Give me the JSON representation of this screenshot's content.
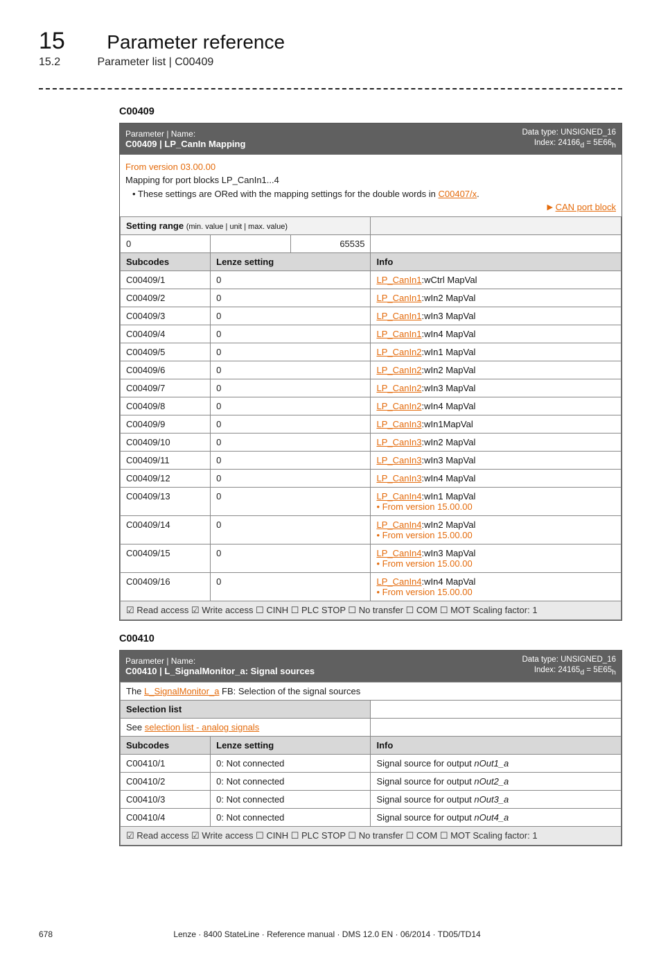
{
  "header": {
    "chapter_number": "15",
    "chapter_title": "Parameter reference",
    "section_number": "15.2",
    "section_title": "Parameter list | C00409"
  },
  "anchor_409": "C00409",
  "table409": {
    "head_small": "Parameter | Name:",
    "head_name": "C00409 | LP_CanIn Mapping",
    "dtype": "Data type: UNSIGNED_16",
    "idx_prefix": "Index: 24166",
    "idx_d": "d",
    "idx_mid": " = 5E66",
    "idx_h": "h",
    "desc_version": "From version 03.00.00",
    "desc_mapping": "Mapping for port blocks LP_CanIn1...4",
    "desc_bullet_pre": "• These settings are ORed with the mapping settings for the double words in ",
    "desc_bullet_link": "C00407/x",
    "desc_bullet_post": ".",
    "right_link": "CAN port block",
    "setting_range_label": "Setting range ",
    "setting_range_small": "(min. value | unit | max. value)",
    "range_min": "0",
    "range_max": "65535",
    "col_subcodes": "Subcodes",
    "col_lenze": "Lenze setting",
    "col_info": "Info",
    "rows": [
      {
        "sc": "C00409/1",
        "ls": "0",
        "link": "LP_CanIn1",
        "suffix": ":wCtrl MapVal",
        "extra": ""
      },
      {
        "sc": "C00409/2",
        "ls": "0",
        "link": "LP_CanIn1",
        "suffix": ":wIn2 MapVal",
        "extra": ""
      },
      {
        "sc": "C00409/3",
        "ls": "0",
        "link": "LP_CanIn1",
        "suffix": ":wIn3 MapVal",
        "extra": ""
      },
      {
        "sc": "C00409/4",
        "ls": "0",
        "link": "LP_CanIn1",
        "suffix": ":wIn4 MapVal",
        "extra": ""
      },
      {
        "sc": "C00409/5",
        "ls": "0",
        "link": "LP_CanIn2",
        "suffix": ":wIn1 MapVal",
        "extra": ""
      },
      {
        "sc": "C00409/6",
        "ls": "0",
        "link": "LP_CanIn2",
        "suffix": ":wIn2 MapVal",
        "extra": ""
      },
      {
        "sc": "C00409/7",
        "ls": "0",
        "link": "LP_CanIn2",
        "suffix": ":wIn3 MapVal",
        "extra": ""
      },
      {
        "sc": "C00409/8",
        "ls": "0",
        "link": "LP_CanIn2",
        "suffix": ":wIn4 MapVal",
        "extra": ""
      },
      {
        "sc": "C00409/9",
        "ls": "0",
        "link": "LP_CanIn3",
        "suffix": ":wIn1MapVal",
        "extra": ""
      },
      {
        "sc": "C00409/10",
        "ls": "0",
        "link": "LP_CanIn3",
        "suffix": ":wIn2 MapVal",
        "extra": ""
      },
      {
        "sc": "C00409/11",
        "ls": "0",
        "link": "LP_CanIn3",
        "suffix": ":wIn3 MapVal",
        "extra": ""
      },
      {
        "sc": "C00409/12",
        "ls": "0",
        "link": "LP_CanIn3",
        "suffix": ":wIn4 MapVal",
        "extra": ""
      },
      {
        "sc": "C00409/13",
        "ls": "0",
        "link": "LP_CanIn4",
        "suffix": ":wIn1 MapVal",
        "extra": "From version 15.00.00"
      },
      {
        "sc": "C00409/14",
        "ls": "0",
        "link": "LP_CanIn4",
        "suffix": ":wIn2 MapVal",
        "extra": "From version 15.00.00"
      },
      {
        "sc": "C00409/15",
        "ls": "0",
        "link": "LP_CanIn4",
        "suffix": ":wIn3 MapVal",
        "extra": "From version 15.00.00"
      },
      {
        "sc": "C00409/16",
        "ls": "0",
        "link": "LP_CanIn4",
        "suffix": ":wIn4 MapVal",
        "extra": "From version 15.00.00"
      }
    ],
    "footer": "☑ Read access   ☑ Write access   ☐ CINH   ☐ PLC STOP   ☐ No transfer   ☐ COM   ☐ MOT    Scaling factor: 1"
  },
  "anchor_410": "C00410",
  "table410": {
    "head_small": "Parameter | Name:",
    "head_name": "C00410 | L_SignalMonitor_a: Signal sources",
    "dtype": "Data type: UNSIGNED_16",
    "idx_prefix": "Index: 24165",
    "idx_d": "d",
    "idx_mid": " = 5E65",
    "idx_h": "h",
    "desc_pre": "The ",
    "desc_link": "L_SignalMonitor_a",
    "desc_post": " FB: Selection of the signal sources",
    "sel_list_label": "Selection list",
    "sel_link": "selection list - analog signals",
    "sel_link_pre": "See ",
    "col_subcodes": "Subcodes",
    "col_lenze": "Lenze setting",
    "col_info": "Info",
    "rows": [
      {
        "sc": "C00410/1",
        "ls": "0: Not connected",
        "info_pre": "Signal source for output ",
        "info_em": "nOut1_a"
      },
      {
        "sc": "C00410/2",
        "ls": "0: Not connected",
        "info_pre": "Signal source for output ",
        "info_em": "nOut2_a"
      },
      {
        "sc": "C00410/3",
        "ls": "0: Not connected",
        "info_pre": "Signal source for output ",
        "info_em": "nOut3_a"
      },
      {
        "sc": "C00410/4",
        "ls": "0: Not connected",
        "info_pre": "Signal source for output ",
        "info_em": "nOut4_a"
      }
    ],
    "footer": "☑ Read access   ☑ Write access   ☐ CINH   ☐ PLC STOP   ☐ No transfer   ☐ COM   ☐ MOT    Scaling factor: 1"
  },
  "footer": {
    "page": "678",
    "center": "Lenze · 8400 StateLine · Reference manual · DMS 12.0 EN · 06/2014 · TD05/TD14"
  }
}
